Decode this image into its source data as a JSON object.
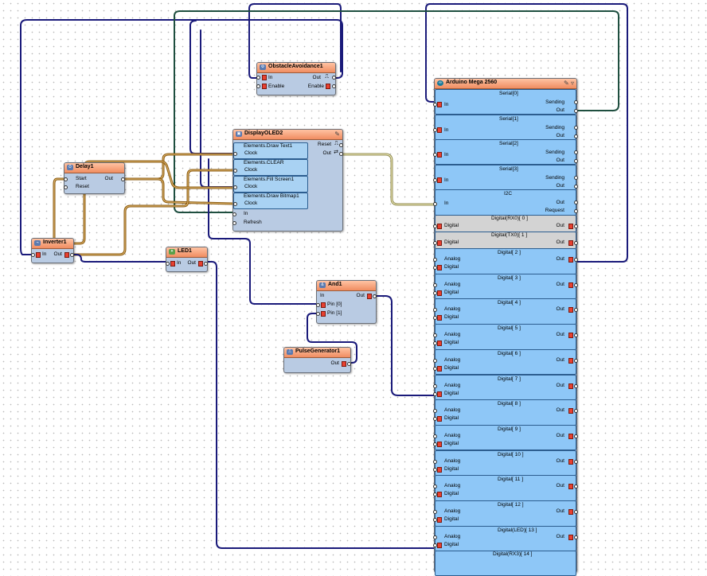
{
  "obstacle": {
    "title": "ObstacleAvoidance1",
    "in": "In",
    "enable": "Enable",
    "out": "Out",
    "enable_out": "Enable"
  },
  "oled": {
    "title": "DisplayOLED2",
    "reset": "Reset",
    "out": "Out",
    "in": "In",
    "refresh": "Refresh",
    "clock": "Clock",
    "elements": [
      "Elements.Draw Text1",
      "Elements.CLEAR",
      "Elements.Fill Screen1",
      "Elements.Draw Bitmap1"
    ]
  },
  "delay": {
    "title": "Delay1",
    "start": "Start",
    "reset": "Reset",
    "out": "Out"
  },
  "inverter": {
    "title": "Inverter1",
    "in": "In",
    "out": "Out"
  },
  "led": {
    "title": "LED1",
    "in": "In",
    "out": "Out"
  },
  "and": {
    "title": "And1",
    "in": "In",
    "pin0": "Pin [0]",
    "pin1": "Pin [1]",
    "out": "Out"
  },
  "pulse": {
    "title": "PulseGenerator1",
    "out": "Out"
  },
  "arduino": {
    "title": "Arduino Mega 2560",
    "serial": [
      {
        "title": "Serial[0]",
        "sending": "Sending",
        "out": "Out",
        "in": "In"
      },
      {
        "title": "Serial[1]",
        "sending": "Sending",
        "out": "Out",
        "in": "In"
      },
      {
        "title": "Serial[2]",
        "sending": "Sending",
        "out": "Out",
        "in": "In"
      },
      {
        "title": "Serial[3]",
        "sending": "Sending",
        "out": "Out",
        "in": "In"
      }
    ],
    "i2c": {
      "title": "I2C",
      "in": "In",
      "out": "Out",
      "request": "Request"
    },
    "rx": {
      "title": "Digital(RX0)[ 0 ]",
      "label": "Digital",
      "out": "Out"
    },
    "tx": {
      "title": "Digital(TX0)[ 1 ]",
      "label": "Digital",
      "out": "Out"
    },
    "digital": [
      {
        "title": "Digital[ 2 ]"
      },
      {
        "title": "Digital[ 3 ]"
      },
      {
        "title": "Digital[ 4 ]"
      },
      {
        "title": "Digital[ 5 ]"
      },
      {
        "title": "Digital[ 6 ]"
      },
      {
        "title": "Digital[ 7 ]"
      },
      {
        "title": "Digital[ 8 ]"
      },
      {
        "title": "Digital[ 9 ]"
      },
      {
        "title": "Digital[ 10 ]"
      },
      {
        "title": "Digital[ 11 ]"
      },
      {
        "title": "Digital[ 12 ]"
      },
      {
        "title": "Digital(LED)[ 13 ]"
      }
    ],
    "analog": "Analog",
    "digital_label": "Digital",
    "out": "Out",
    "last": {
      "title": "Digital(RX3)[ 14 ]"
    }
  },
  "wire_colors": {
    "digital": "#1a1a7a",
    "clock": "#8a5a10",
    "analog": "#1f4f40",
    "i2c": "#b5b070"
  }
}
